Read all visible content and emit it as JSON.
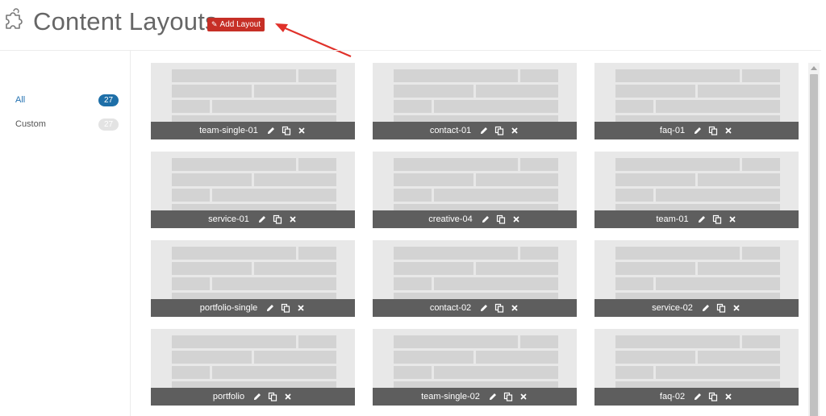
{
  "header": {
    "title": "Content Layouts",
    "add_button_label": "Add Layout",
    "icon": "puzzle-icon"
  },
  "sidebar": {
    "filters": [
      {
        "label": "All",
        "count": "27",
        "active": true
      },
      {
        "label": "Custom",
        "count": "27",
        "active": false
      }
    ]
  },
  "layouts": [
    {
      "name": "team-single-01"
    },
    {
      "name": "contact-01"
    },
    {
      "name": "faq-01"
    },
    {
      "name": "service-01"
    },
    {
      "name": "creative-04"
    },
    {
      "name": "team-01"
    },
    {
      "name": "portfolio-single"
    },
    {
      "name": "contact-02"
    },
    {
      "name": "service-02"
    },
    {
      "name": "portfolio"
    },
    {
      "name": "team-single-02"
    },
    {
      "name": "faq-02"
    }
  ],
  "card_actions": [
    "edit-icon",
    "duplicate-icon",
    "delete-icon"
  ],
  "colors": {
    "accent": "#1e6fa8",
    "add_button": "#c62f26",
    "card_bg": "#e8e8e8",
    "card_bar": "#5e5e5e",
    "arrow": "#e0312a"
  }
}
